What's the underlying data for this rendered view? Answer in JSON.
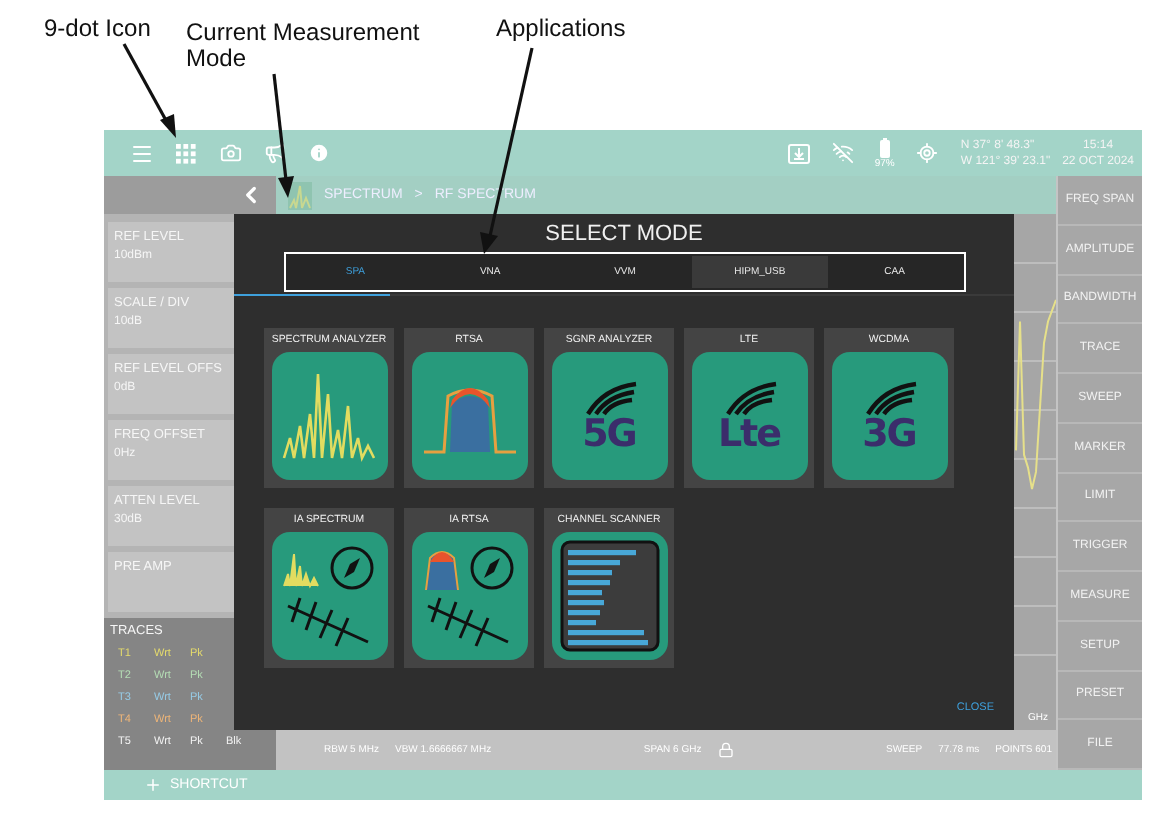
{
  "annotations": [
    {
      "label": "9-dot Icon"
    },
    {
      "label": "Current Measurement Mode"
    },
    {
      "label": "Applications"
    }
  ],
  "top_bar": {
    "battery": "97%",
    "latitude": "N 37° 8' 48.3\"",
    "longitude": "W 121° 39' 23.1\"",
    "time": "15:14",
    "date": "22 OCT 2024"
  },
  "breadcrumb": {
    "mode": "SPECTRUM",
    "separator": ">",
    "page": "RF SPECTRUM"
  },
  "settings": [
    {
      "label": "REF LEVEL",
      "value": "10dBm"
    },
    {
      "label": "SCALE / DIV",
      "value": "10dB"
    },
    {
      "label": "REF LEVEL OFFS",
      "value": "0dB"
    },
    {
      "label": "FREQ OFFSET",
      "value": "0Hz"
    },
    {
      "label": "ATTEN LEVEL",
      "value": "30dB"
    },
    {
      "label": "PRE AMP"
    }
  ],
  "traces": {
    "title": "TRACES",
    "rows": [
      {
        "cells": [
          "T1",
          "Wrt",
          "Pk"
        ],
        "color": "#e4da6c"
      },
      {
        "cells": [
          "T2",
          "Wrt",
          "Pk"
        ],
        "color": "#b4dcb4"
      },
      {
        "cells": [
          "T3",
          "Wrt",
          "Pk"
        ],
        "color": "#96cbe6"
      },
      {
        "cells": [
          "T4",
          "Wrt",
          "Pk"
        ],
        "color": "#eeb578"
      },
      {
        "cells": [
          "T5",
          "Wrt",
          "Pk",
          "Blk"
        ],
        "color": "#f2f2f2"
      }
    ]
  },
  "status": {
    "freq_unit": "GHz",
    "rbw": "RBW 5 MHz",
    "vbw": "VBW 1.6666667 MHz",
    "span": "SPAN 6 GHz",
    "sweep_label": "SWEEP",
    "sweep": "77.78 ms",
    "points": "POINTS 601"
  },
  "right_menu": [
    "FREQ SPAN",
    "AMPLITUDE",
    "BANDWIDTH",
    "TRACE",
    "SWEEP",
    "MARKER",
    "LIMIT",
    "TRIGGER",
    "MEASURE",
    "SETUP",
    "PRESET",
    "FILE"
  ],
  "modal": {
    "title": "SELECT MODE",
    "tabs": [
      {
        "label": "SPA",
        "selected": true,
        "hovered": false
      },
      {
        "label": "VNA",
        "selected": false,
        "hovered": false
      },
      {
        "label": "VVM",
        "selected": false,
        "hovered": false
      },
      {
        "label": "HIPM_USB",
        "selected": false,
        "hovered": true
      },
      {
        "label": "CAA",
        "selected": false,
        "hovered": false
      }
    ],
    "modes": [
      {
        "label": "SPECTRUM ANALYZER",
        "kind": "spectrum"
      },
      {
        "label": "RTSA",
        "kind": "rtsa"
      },
      {
        "label": "SGNR ANALYZER",
        "kind": "logo",
        "logo": "5G"
      },
      {
        "label": "LTE",
        "kind": "logo",
        "logo": "Lte"
      },
      {
        "label": "WCDMA",
        "kind": "logo",
        "logo": "3G"
      },
      {
        "label": "IA SPECTRUM",
        "kind": "ia_spectrum"
      },
      {
        "label": "IA RTSA",
        "kind": "ia_rtsa"
      },
      {
        "label": "CHANNEL SCANNER",
        "kind": "scanner"
      }
    ],
    "close": "CLOSE"
  },
  "shortcut": {
    "label": "SHORTCUT"
  }
}
